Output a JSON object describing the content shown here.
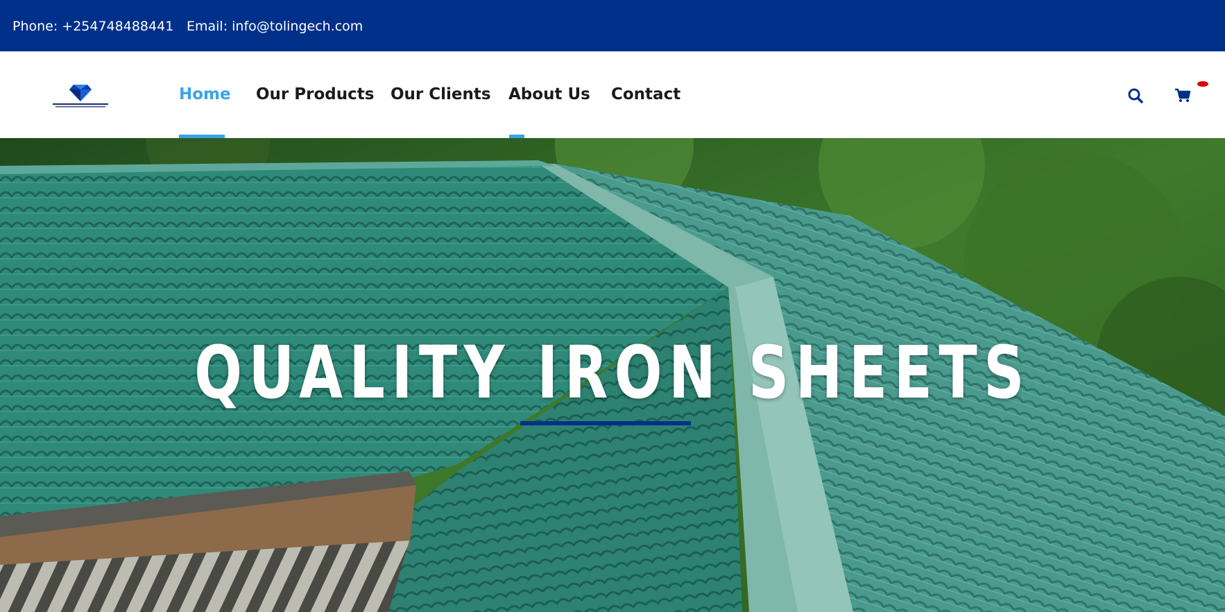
{
  "topbar": {
    "phone": "Phone: +254748488441",
    "email": "Email: info@tolingech.com"
  },
  "header": {
    "logo_icon": "diamond-logo-icon",
    "nav": [
      {
        "label": "Home",
        "active": true
      },
      {
        "label": "Our Products",
        "active": false
      },
      {
        "label": "Our Clients",
        "active": false
      },
      {
        "label": "About Us",
        "active": false
      },
      {
        "label": "Contact",
        "active": false
      }
    ],
    "icons": [
      "search-icon",
      "cart-icon"
    ]
  },
  "hero": {
    "title": "QUALITY IRON SHEETS"
  },
  "colors": {
    "topbar_bg": "#00308a",
    "nav_active": "#3aa3e6",
    "nav_text": "#1a1a1a",
    "hero_rule": "#00308a",
    "cart_badge": "#e10000"
  }
}
